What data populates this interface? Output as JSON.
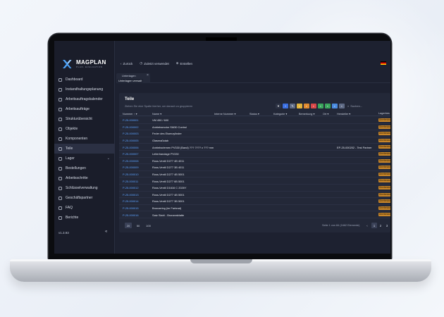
{
  "logo": {
    "name": "MAGPLAN",
    "sub": "PLAN. EVALUATION"
  },
  "topbar": {
    "back": "Zurück",
    "recent": "Zuletzt verwendet",
    "create": "Erstellen"
  },
  "sidebar": {
    "items": [
      {
        "label": "Dashboard",
        "icon": "home-icon"
      },
      {
        "label": "Instandhaltungsplanung",
        "icon": "calendar-icon"
      },
      {
        "label": "Arbeitsauftragskalender",
        "icon": "calendar-icon"
      },
      {
        "label": "Arbeitsaufträge",
        "icon": "clipboard-icon"
      },
      {
        "label": "Strukturübersicht",
        "icon": "tree-icon"
      },
      {
        "label": "Objekte",
        "icon": "cube-icon"
      },
      {
        "label": "Komponenten",
        "icon": "gear-icon"
      },
      {
        "label": "Teile",
        "icon": "wrench-icon",
        "active": true
      },
      {
        "label": "Lager",
        "icon": "warehouse-icon",
        "expandable": true
      },
      {
        "label": "Bestellungen",
        "icon": "cart-icon"
      },
      {
        "label": "Arbeitsschritte",
        "icon": "steps-icon"
      },
      {
        "label": "Schlüsselverwaltung",
        "icon": "key-icon"
      },
      {
        "label": "Geschäftspartner",
        "icon": "partner-icon"
      },
      {
        "label": "FAQ",
        "icon": "question-icon"
      },
      {
        "label": "Berichte",
        "icon": "report-icon"
      }
    ],
    "version": "v1.3.93",
    "collapse": "«"
  },
  "tab": {
    "label": "Unterlagen",
    "sub": "Unterlagen verwalt",
    "close": "×"
  },
  "panel": {
    "title": "Teile",
    "group_hint": "Ziehen Sie eine Spalte hierher, um danach zu gruppieren",
    "search_placeholder": "Suchen...",
    "columns": {
      "number": "Nummer",
      "name": "Name",
      "internal": "Interne Nummer",
      "status": "Status",
      "category": "Kategorie",
      "remark": "Bemerkung",
      "location": "Ort",
      "manufacturer": "Hersteller",
      "storage": "Lagerbes"
    },
    "rows": [
      {
        "number": "P-25-000001",
        "name": "VM 450 / 600",
        "supplier": "",
        "badge": "Überbestand"
      },
      {
        "number": "P-25-000002",
        "name": "Antriebsmotor SM30 Control",
        "supplier": "",
        "badge": "Überbestand"
      },
      {
        "number": "P-25-000003",
        "name": "Feder des Eisenzylinder",
        "supplier": "",
        "badge": "Überbestand"
      },
      {
        "number": "P-25-000005",
        "name": "Glasmaßstab",
        "supplier": "",
        "badge": "Überbestand"
      },
      {
        "number": "P-25-000006",
        "name": "Antriebsriemen PV330 (Band) ??? ???? x ??? mm",
        "supplier": "EP-25-000202 - Test Partner",
        "badge": "Überbestand"
      },
      {
        "number": "P-25-000007",
        "name": "Leiterbandage PV330",
        "supplier": "",
        "badge": "Überbestand"
      },
      {
        "number": "P-25-000008",
        "name": "Ross-Ventil D277 4B 4011",
        "supplier": "",
        "badge": "Überbestand"
      },
      {
        "number": "P-25-000009",
        "name": "Ross-Ventil D277 3B 4011",
        "supplier": "",
        "badge": "Überbestand"
      },
      {
        "number": "P-25-000010",
        "name": "Ross-Ventil D277 4B 5001",
        "supplier": "",
        "badge": "Überbestand"
      },
      {
        "number": "P-25-000011",
        "name": "Ross-Ventil D277 6B 5001",
        "supplier": "",
        "badge": "Überbestand"
      },
      {
        "number": "P-25-000012",
        "name": "Ross-Ventil D1616 C 2026Y",
        "supplier": "",
        "badge": "Überbestand"
      },
      {
        "number": "P-25-000013",
        "name": "Ross-Ventil D277 4B 5001",
        "supplier": "",
        "badge": "Überbestand"
      },
      {
        "number": "P-25-000014",
        "name": "Ross-Ventil D277 3B 5001",
        "supplier": "",
        "badge": "Überbestand"
      },
      {
        "number": "P-25-000015",
        "name": "Bronzering (im Farbrad)",
        "supplier": "",
        "badge": "Überbestand"
      },
      {
        "number": "P-25-000016",
        "name": "Satz Stahl - Bronzeablatte",
        "supplier": "",
        "badge": "Überbestand"
      }
    ],
    "page_sizes": [
      "20",
      "50",
      "100"
    ],
    "page_info": "Seite 1 von 84 (1662 Elemente)",
    "pages": [
      "‹",
      "1",
      "2",
      "3"
    ]
  },
  "colors": {
    "accent": "#5ea3ff",
    "badge": "#c8862a",
    "bg": "#1d2130"
  }
}
